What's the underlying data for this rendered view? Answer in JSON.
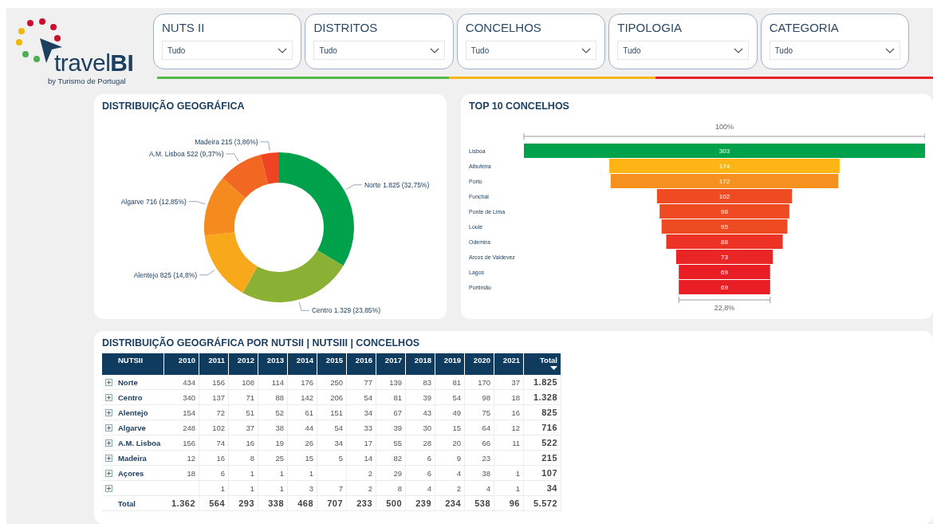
{
  "logo": {
    "name": "travel**BI**",
    "tagline": "by Turismo de Portugal"
  },
  "filters": [
    {
      "label": "NUTS II",
      "value": "Tudo"
    },
    {
      "label": "DISTRITOS",
      "value": "Tudo"
    },
    {
      "label": "CONCELHOS",
      "value": "Tudo"
    },
    {
      "label": "TIPOLOGIA",
      "value": "Tudo"
    },
    {
      "label": "CATEGORIA",
      "value": "Tudo"
    }
  ],
  "geo_card": {
    "title": "DISTRIBUIÇÃO GEOGRÁFICA",
    "chart_data": {
      "type": "donut",
      "categories": [
        "Norte",
        "Centro",
        "Alentejo",
        "Algarve",
        "A.M. Lisboa",
        "Madeira"
      ],
      "values": [
        1825,
        1329,
        825,
        716,
        522,
        215
      ],
      "value_labels": [
        "1.825 (32,75%)",
        "1.329 (23,85%)",
        "825 (14,8%)",
        "716 (12,85%)",
        "522 (9,37%)",
        "215 (3,86%)"
      ]
    }
  },
  "top_card": {
    "title": "TOP 10 CONCELHOS",
    "top_label": "100%",
    "bottom_label": "22,8%",
    "bars": [
      {
        "name": "Lisboa",
        "value": "303"
      },
      {
        "name": "Albufeira",
        "value": "174"
      },
      {
        "name": "Porto",
        "value": "172"
      },
      {
        "name": "Funchal",
        "value": "102"
      },
      {
        "name": "Ponte de Lima",
        "value": "98"
      },
      {
        "name": "Loulé",
        "value": "95"
      },
      {
        "name": "Odemira",
        "value": "88"
      },
      {
        "name": "Arcos de Valdevez",
        "value": "73"
      },
      {
        "name": "Lagos",
        "value": "69"
      },
      {
        "name": "Portimão",
        "value": "69"
      }
    ]
  },
  "table_card": {
    "title": "DISTRIBUIÇÃO GEOGRÁFICA POR NUTSII | NUTSIII | CONCELHOS",
    "row_header": "NUTSII",
    "columns": [
      {
        "label": "2010",
        "sorted": false
      },
      {
        "label": "2011",
        "sorted": false
      },
      {
        "label": "2012",
        "sorted": false
      },
      {
        "label": "2013",
        "sorted": false
      },
      {
        "label": "2014",
        "sorted": false
      },
      {
        "label": "2015",
        "sorted": false
      },
      {
        "label": "2016",
        "sorted": false
      },
      {
        "label": "2017",
        "sorted": false
      },
      {
        "label": "2018",
        "sorted": false
      },
      {
        "label": "2019",
        "sorted": false
      },
      {
        "label": "2020",
        "sorted": false
      },
      {
        "label": "2021",
        "sorted": false
      },
      {
        "label": "Total",
        "sorted": true
      }
    ],
    "rows": [
      {
        "name": "Norte",
        "expanded": false,
        "cells": [
          {
            "text": "434"
          },
          {
            "text": "156"
          },
          {
            "text": "108"
          },
          {
            "text": "114"
          },
          {
            "text": "176"
          },
          {
            "text": "250"
          },
          {
            "text": "77"
          },
          {
            "text": "139"
          },
          {
            "text": "83"
          },
          {
            "text": "81"
          },
          {
            "text": "170"
          },
          {
            "text": "37"
          },
          {
            "text": "1.825"
          }
        ]
      },
      {
        "name": "Centro",
        "expanded": false,
        "cells": [
          {
            "text": "340"
          },
          {
            "text": "137"
          },
          {
            "text": "71"
          },
          {
            "text": "88"
          },
          {
            "text": "142"
          },
          {
            "text": "206"
          },
          {
            "text": "54"
          },
          {
            "text": "81"
          },
          {
            "text": "39"
          },
          {
            "text": "54"
          },
          {
            "text": "98"
          },
          {
            "text": "18"
          },
          {
            "text": "1.328"
          }
        ]
      },
      {
        "name": "Alentejo",
        "expanded": false,
        "cells": [
          {
            "text": "154"
          },
          {
            "text": "72"
          },
          {
            "text": "51"
          },
          {
            "text": "52"
          },
          {
            "text": "61"
          },
          {
            "text": "151"
          },
          {
            "text": "34"
          },
          {
            "text": "67"
          },
          {
            "text": "43"
          },
          {
            "text": "49"
          },
          {
            "text": "75"
          },
          {
            "text": "16"
          },
          {
            "text": "825"
          }
        ]
      },
      {
        "name": "Algarve",
        "expanded": false,
        "cells": [
          {
            "text": "248"
          },
          {
            "text": "102"
          },
          {
            "text": "37"
          },
          {
            "text": "38"
          },
          {
            "text": "44"
          },
          {
            "text": "54"
          },
          {
            "text": "33"
          },
          {
            "text": "39"
          },
          {
            "text": "30"
          },
          {
            "text": "15"
          },
          {
            "text": "64"
          },
          {
            "text": "12"
          },
          {
            "text": "716"
          }
        ]
      },
      {
        "name": "A.M. Lisboa",
        "expanded": false,
        "cells": [
          {
            "text": "156"
          },
          {
            "text": "74"
          },
          {
            "text": "16"
          },
          {
            "text": "19"
          },
          {
            "text": "26"
          },
          {
            "text": "34"
          },
          {
            "text": "17"
          },
          {
            "text": "55"
          },
          {
            "text": "28"
          },
          {
            "text": "20"
          },
          {
            "text": "66"
          },
          {
            "text": "11"
          },
          {
            "text": "522"
          }
        ]
      },
      {
        "name": "Madeira",
        "expanded": false,
        "cells": [
          {
            "text": "12"
          },
          {
            "text": "16"
          },
          {
            "text": "8"
          },
          {
            "text": "25"
          },
          {
            "text": "15"
          },
          {
            "text": "5"
          },
          {
            "text": "14"
          },
          {
            "text": "82"
          },
          {
            "text": "6"
          },
          {
            "text": "9"
          },
          {
            "text": "23"
          },
          {},
          {
            "text": "215"
          }
        ]
      },
      {
        "name": "Açores",
        "expanded": false,
        "cells": [
          {
            "text": "18"
          },
          {
            "text": "6"
          },
          {
            "text": "1"
          },
          {
            "text": "1"
          },
          {
            "text": "1"
          },
          {},
          {
            "text": "2"
          },
          {
            "text": "29"
          },
          {
            "text": "6"
          },
          {
            "text": "4"
          },
          {
            "text": "38"
          },
          {
            "text": "1"
          },
          {
            "text": "107"
          }
        ]
      },
      {
        "name": "",
        "expanded": false,
        "cells": [
          {},
          {
            "text": "1"
          },
          {
            "text": "1"
          },
          {
            "text": "1"
          },
          {
            "text": "3"
          },
          {
            "text": "7"
          },
          {
            "text": "2"
          },
          {
            "text": "8"
          },
          {
            "text": "4"
          },
          {
            "text": "2"
          },
          {
            "text": "4"
          },
          {
            "text": "1"
          },
          {
            "text": "34"
          }
        ]
      }
    ],
    "total_row": {
      "label": "Total",
      "values": [
        "1.362",
        "564",
        "293",
        "338",
        "468",
        "707",
        "233",
        "500",
        "239",
        "234",
        "538",
        "96",
        "5.572"
      ]
    }
  }
}
